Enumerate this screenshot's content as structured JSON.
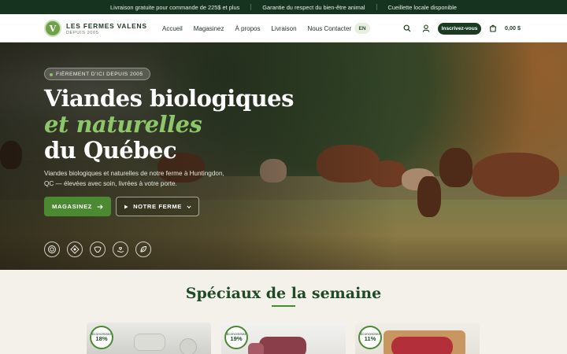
{
  "announcements": [
    "Livraison gratuite pour commande de 225$ et plus",
    "Garantie du respect du bien-être animal",
    "Cueillette locale disponible"
  ],
  "brand": {
    "name": "LES FERMES VALENS",
    "since": "DEPUIS 2005",
    "logo_letter": "V"
  },
  "nav": {
    "items": [
      "Accueil",
      "Magasinez",
      "À propos",
      "Livraison",
      "Nous Contacter"
    ],
    "lang": "EN",
    "cta": "Inscrivez-vous",
    "cart_total": "0,00 $"
  },
  "hero": {
    "badge": "FIÈREMENT D'ICI DEPUIS 2005",
    "title_line1": "Viandes biologiques",
    "title_line2": "et naturelles",
    "title_line3": "du Québec",
    "lead": "Viandes biologiques et naturelles de notre ferme à Huntingdon, QC — élevées avec soin, livrées à votre porte.",
    "btn_shop": "MAGASINEZ",
    "btn_farm": "NOTRE FERME",
    "certifications": [
      "certification-seal-icon",
      "organic-badge-icon",
      "cow-badge-icon",
      "hand-care-icon",
      "leaf-badge-icon"
    ]
  },
  "specials": {
    "title": "Spéciaux de la semaine",
    "cards": [
      {
        "save_label": "Économisez",
        "save_pct": "18%"
      },
      {
        "save_label": "Économisez",
        "save_pct": "19%"
      },
      {
        "save_label": "Économisez",
        "save_pct": "11%"
      }
    ]
  },
  "colors": {
    "topbar": "#16331f",
    "accent_green": "#4b8a32",
    "title_green": "#1f4a26",
    "light_green": "#8cc86a"
  }
}
